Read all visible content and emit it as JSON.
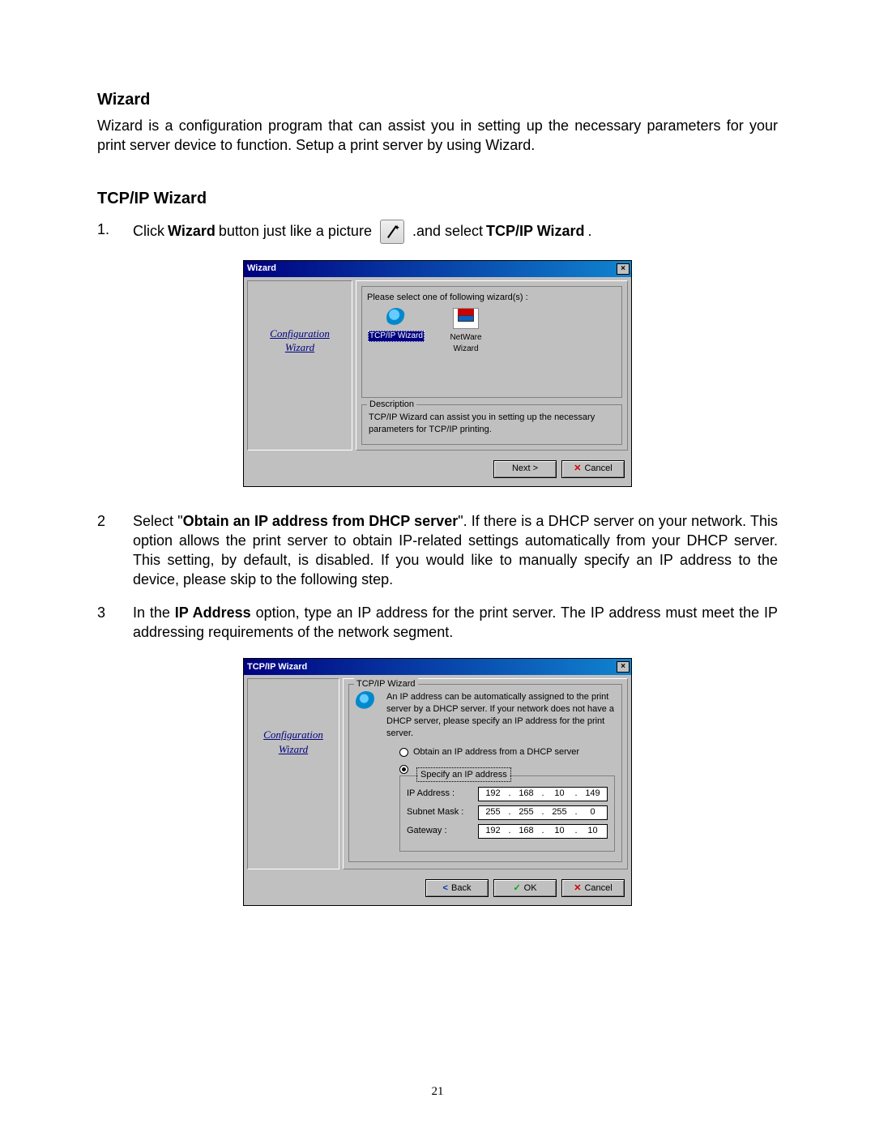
{
  "sections": {
    "wizard_heading": "Wizard",
    "wizard_intro": "Wizard is a configuration program that can assist you in setting up the necessary parameters for your print server device to function. Setup a print server by using Wizard.",
    "tcpip_heading": "TCP/IP Wizard"
  },
  "steps": {
    "s1_num": "1.",
    "s1_a": "Click ",
    "s1_b_bold": "Wizard",
    "s1_c": " button just like a picture",
    "s1_d": ".and select ",
    "s1_e_bold": "TCP/IP Wizard",
    "s1_f": ".",
    "s2_num": "2",
    "s2_a": "Select  \"",
    "s2_b_bold": "Obtain an IP address from DHCP server",
    "s2_c": "\". If there is a DHCP server on your network. This option allows the print server to obtain IP-related settings automatically from your DHCP server. This setting, by default, is disabled. If you would like to manually specify an IP address to the device, please skip to the following step.",
    "s3_num": "3",
    "s3_a": "In the ",
    "s3_b_bold": "IP Address",
    "s3_c": " option, type an IP address for the print server. The IP address must meet the IP addressing requirements of the network segment."
  },
  "dialog1": {
    "title": "Wizard",
    "side_line1": "Configuration",
    "side_line2": "Wizard",
    "prompt": "Please select one of following wizard(s) :",
    "item_tcpip": "TCP/IP Wizard",
    "item_netware_l1": "NetWare",
    "item_netware_l2": "Wizard",
    "desc_legend": "Description",
    "desc_text": "TCP/IP Wizard can assist you in setting up the necessary parameters for TCP/IP printing.",
    "btn_next": "Next  >",
    "btn_cancel": "Cancel"
  },
  "dialog2": {
    "title": "TCP/IP Wizard",
    "side_line1": "Configuration",
    "side_line2": "Wizard",
    "group_legend": "TCP/IP Wizard",
    "intro": "An IP address can be automatically assigned to the print server by a DHCP server. If your network does not have a DHCP server, please specify an IP address for the print server.",
    "opt_dhcp": "Obtain an IP address from a DHCP server",
    "opt_specify": "Specify an IP address",
    "lbl_ip": "IP Address :",
    "lbl_mask": "Subnet Mask :",
    "lbl_gw": "Gateway :",
    "ip": [
      "192",
      "168",
      "10",
      "149"
    ],
    "mask": [
      "255",
      "255",
      "255",
      "0"
    ],
    "gw": [
      "192",
      "168",
      "10",
      "10"
    ],
    "btn_back": "Back",
    "btn_ok": "OK",
    "btn_cancel": "Cancel"
  },
  "page_number": "21"
}
